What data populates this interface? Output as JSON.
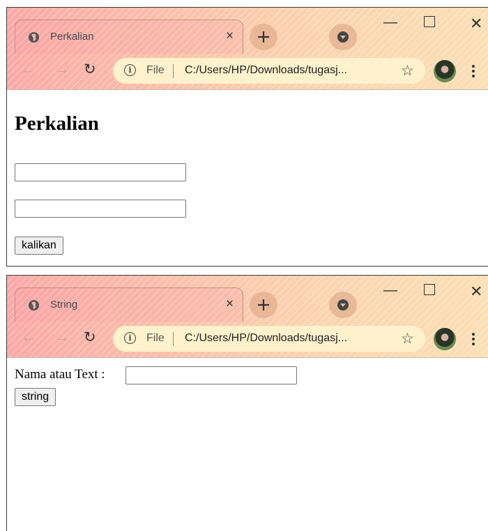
{
  "windows": [
    {
      "tab_title": "Perkalian",
      "address": {
        "scheme_label": "File",
        "url": "C:/Users/HP/Downloads/tugasj..."
      },
      "page": {
        "heading": "Perkalian",
        "inputs": [
          {
            "value": ""
          },
          {
            "value": ""
          }
        ],
        "button_label": "kalikan"
      }
    },
    {
      "tab_title": "String",
      "address": {
        "scheme_label": "File",
        "url": "C:/Users/HP/Downloads/tugasj..."
      },
      "page": {
        "label": "Nama atau Text :",
        "input_value": "",
        "button_label": "string"
      }
    }
  ],
  "chrome": {
    "icons": [
      "globe-icon",
      "close-icon",
      "new-tab-icon",
      "profile-menu-icon",
      "minimize-icon",
      "maximize-icon",
      "window-close-icon",
      "back-icon",
      "forward-icon",
      "reload-icon",
      "info-icon",
      "star-icon",
      "avatar",
      "menu-icon"
    ],
    "colors": {
      "frame_start": "#fba9a7",
      "frame_end": "#fbe0b6",
      "omnibox": "#fff2cc"
    }
  }
}
